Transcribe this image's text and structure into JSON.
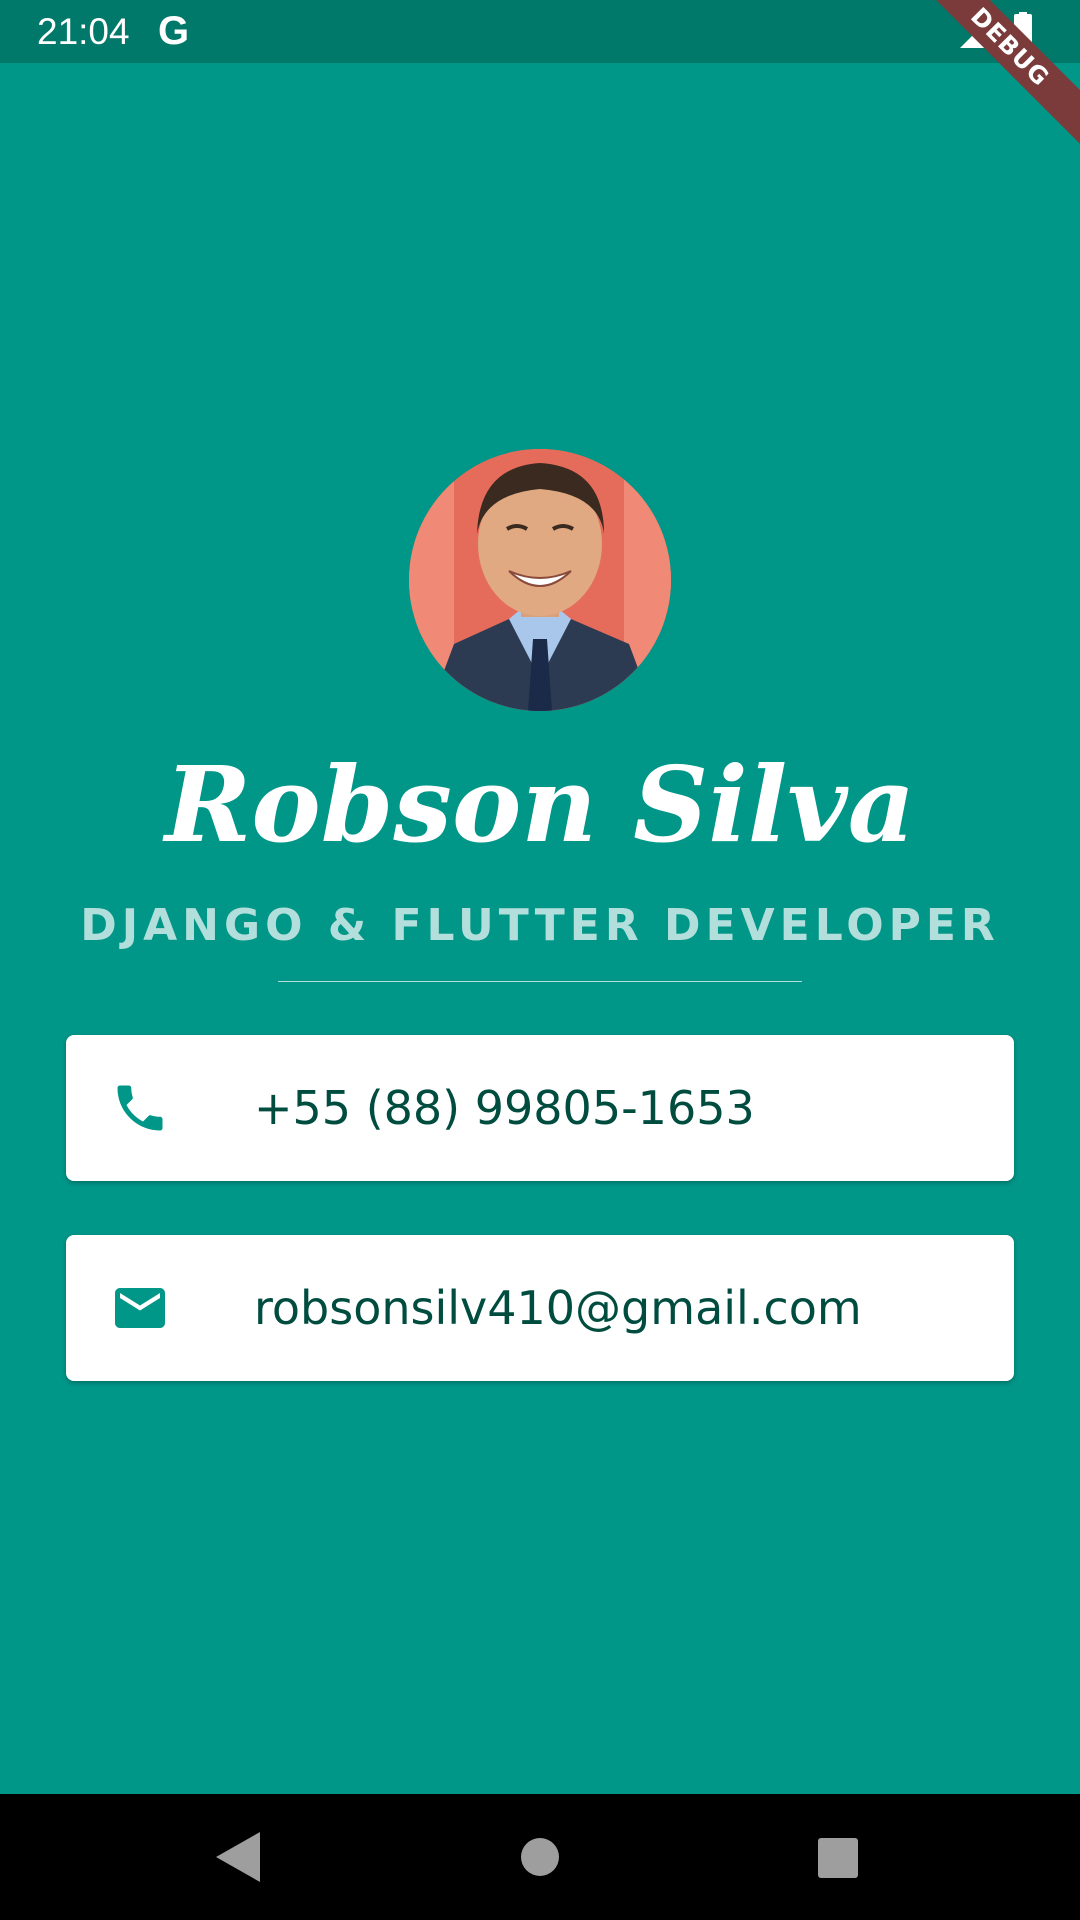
{
  "status_bar": {
    "time": "21:04",
    "g_label": "G",
    "debug_label": "DEBUG"
  },
  "profile": {
    "name": "Robson Silva",
    "title": "DJANGO & FLUTTER DEVELOPER"
  },
  "contacts": {
    "phone": "+55 (88) 99805-1653",
    "email": "robsonsilv410@gmail.com"
  },
  "icons": {
    "phone": "phone-icon",
    "email": "mail-icon",
    "back": "back-icon",
    "home": "home-icon",
    "recent": "recent-apps-icon"
  },
  "colors": {
    "background": "#009688",
    "status_bar": "#00796b",
    "card_text": "#004d40",
    "subtitle": "#b2dfdb",
    "debug_banner": "#7b3b3b"
  }
}
